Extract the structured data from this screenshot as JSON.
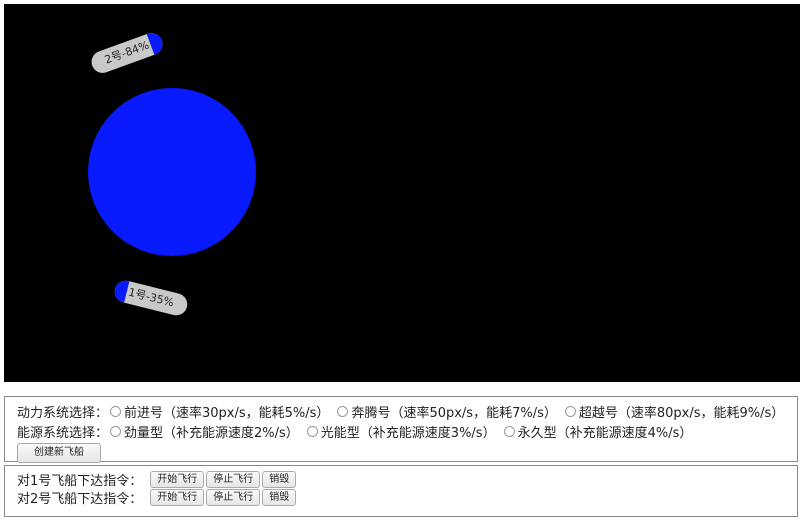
{
  "space": {
    "background": "#000000",
    "planet": {
      "color": "#0a1aff"
    },
    "ships": [
      {
        "label": "2号-84%",
        "energy_percent": 84,
        "energy_color": "#0a1aff",
        "body_color": "#c9c9c9"
      },
      {
        "label": "1号-35%",
        "energy_percent": 35,
        "energy_color": "#0a1aff",
        "body_color": "#c9c9c9"
      }
    ]
  },
  "create_panel": {
    "power_label": "动力系统选择：",
    "power_options": [
      "前进号（速率30px/s，能耗5%/s）",
      "奔腾号（速率50px/s，能耗7%/s）",
      "超越号（速率80px/s，能耗9%/s）"
    ],
    "energy_label": "能源系统选择：",
    "energy_options": [
      "劲量型（补充能源速度2%/s）",
      "光能型（补充能源速度3%/s）",
      "永久型（补充能源速度4%/s）"
    ],
    "create_button": "创建新飞船"
  },
  "command_panel": {
    "rows": [
      {
        "label": "对1号飞船下达指令：",
        "start": "开始飞行",
        "stop": "停止飞行",
        "destroy": "销毁"
      },
      {
        "label": "对2号飞船下达指令：",
        "start": "开始飞行",
        "stop": "停止飞行",
        "destroy": "销毁"
      }
    ]
  }
}
